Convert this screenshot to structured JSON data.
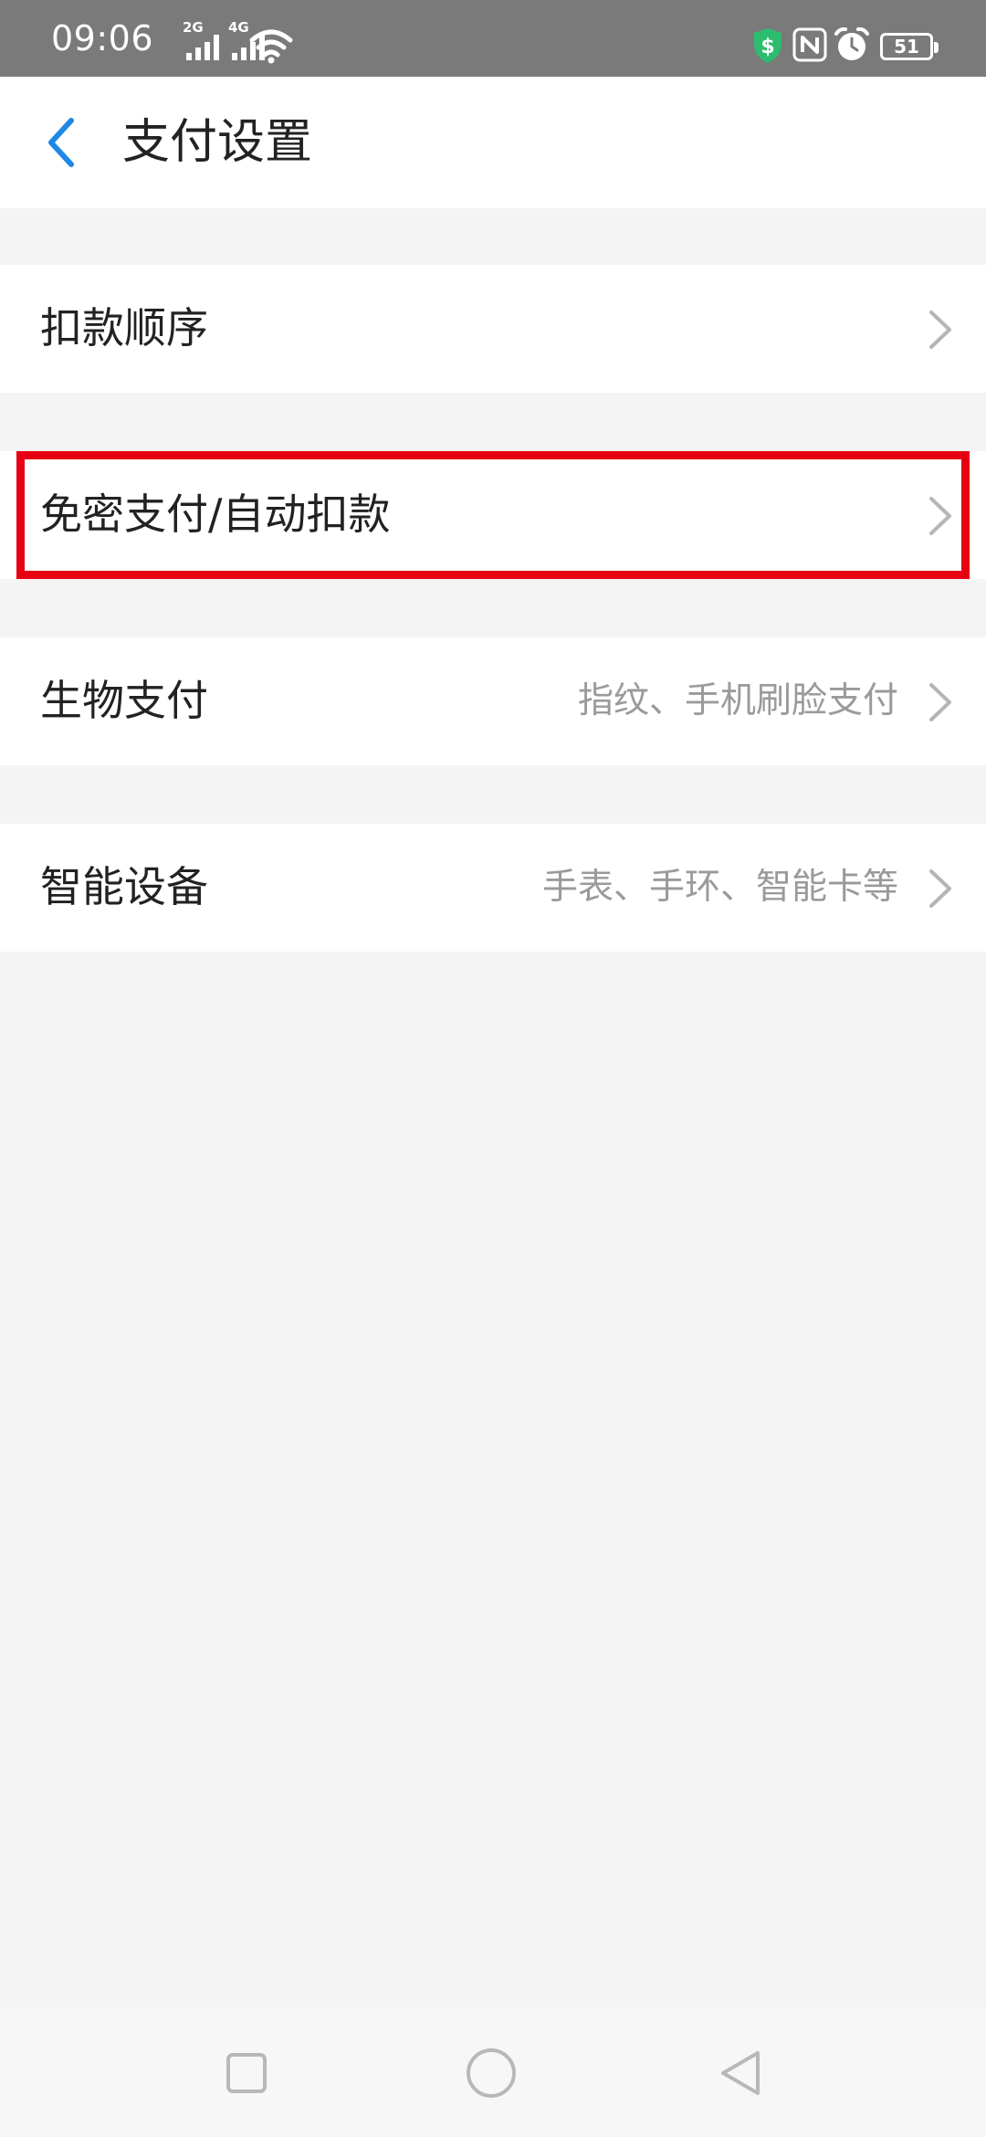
{
  "status_bar": {
    "time": "09:06",
    "signal_1_type": "2G",
    "signal_2_type": "4G",
    "battery_level": "51",
    "icons": [
      "signal-icon",
      "signal-icon",
      "wifi-icon",
      "security-shield-icon",
      "nfc-icon",
      "alarm-clock-icon",
      "battery-icon"
    ]
  },
  "header": {
    "title": "支付设置",
    "back_icon": "chevron-left-icon"
  },
  "settings": {
    "items": [
      {
        "label": "扣款顺序",
        "subtitle": ""
      },
      {
        "label": "免密支付/自动扣款",
        "subtitle": ""
      },
      {
        "label": "生物支付",
        "subtitle": "指纹、手机刷脸支付"
      },
      {
        "label": "智能设备",
        "subtitle": "手表、手环、智能卡等"
      }
    ]
  },
  "colors": {
    "accent": "#1e88e5",
    "highlight": "#e60012",
    "background": "#f4f4f5",
    "status_bar": "#7a7a7a"
  },
  "nav": {
    "buttons": [
      "recent-apps-icon",
      "home-icon",
      "back-icon"
    ]
  }
}
